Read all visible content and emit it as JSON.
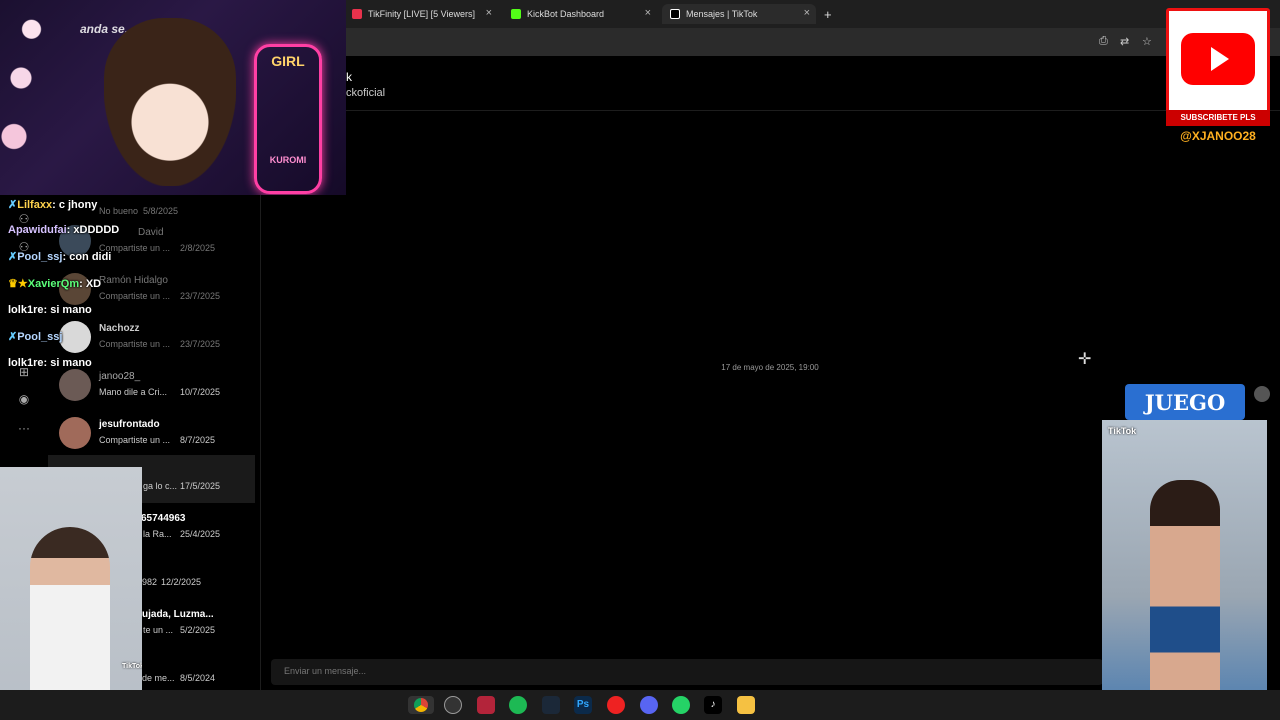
{
  "browser": {
    "tabs": [
      {
        "label": "TikFinity [LIVE] [5 Viewers]",
        "color": "#e8324c"
      },
      {
        "label": "KickBot Dashboard",
        "color": "#53fc18"
      },
      {
        "label": "Mensajes | TikTok",
        "color": "#ffffff"
      }
    ],
    "new_tab": "+",
    "close": "×"
  },
  "conversation": {
    "name": "k",
    "username": "ckoficial",
    "timestamp": "17 de mayo de 2025, 19:00",
    "composer_placeholder": "Enviar un mensaje..."
  },
  "sidebar": {
    "more": "···",
    "items": [
      {
        "name": "",
        "preview": "No bueno",
        "date": "5/8/2025",
        "dim": true
      },
      {
        "name": "David",
        "preview": "Compartiste un ...",
        "date": "2/8/2025",
        "dim": true
      },
      {
        "name": "Ramón Hidalgo",
        "preview": "Compartiste un ...",
        "date": "23/7/2025",
        "dim": true
      },
      {
        "name": "Nachozz",
        "preview": "Compartiste un ...",
        "date": "23/7/2025",
        "dim": true
      },
      {
        "name": "janoo28_",
        "preview": "Mano dile a Cri...",
        "date": "10/7/2025",
        "dim": true
      },
      {
        "name": "jesufrontado",
        "preview": "Compartiste un ...",
        "date": "8/7/2025",
        "dim": false
      },
      {
        "name": "",
        "preview": "ga lo c...",
        "date": "17/5/2025",
        "dim": false,
        "selected": true
      },
      {
        "name": "65744963",
        "preview": "la Ra...",
        "date": "25/4/2025",
        "dim": false
      },
      {
        "name": "",
        "preview": "982",
        "date": "12/2/2025",
        "dim": false
      },
      {
        "name": "ujada, Luzma...",
        "preview": "te un ...",
        "date": "5/2/2025",
        "dim": false
      },
      {
        "name": "",
        "preview": "de me...",
        "date": "8/5/2024",
        "dim": false
      }
    ]
  },
  "stream": {
    "chat": [
      {
        "user": "Lilfaxx",
        "text": "c jhony",
        "color": "gold"
      },
      {
        "user": "Apawidufai",
        "text": "xDDDDD",
        "color": "blue"
      },
      {
        "user": "Pool_ssj",
        "text": "con didi",
        "color": "blue"
      },
      {
        "user": "XavierQm",
        "text": "XD",
        "color": "green"
      },
      {
        "user": "lolk1re",
        "text": "si mano",
        "color": "none"
      },
      {
        "user": "Pool_ssj",
        "text": "",
        "color": "blue"
      },
      {
        "user": "lolk1re",
        "text": "si mano",
        "color": "none"
      }
    ],
    "webcam": {
      "sign": "GIRL",
      "sign2": "KUROMI",
      "caption": "anda se..."
    },
    "youtube": {
      "label": "SUBSCRIBETE PLS",
      "handle": "@XJANOO28"
    },
    "juego": "JUEGO",
    "tiktok_tag": "TikTok"
  },
  "taskbar": {
    "icons": [
      "chrome",
      "obs",
      "tiktok-live",
      "spotify",
      "steam",
      "photoshop",
      "app-red",
      "discord",
      "whatsapp",
      "tiktok",
      "explorer"
    ],
    "photoshop_label": "Ps"
  },
  "colors": {
    "youtube_red": "#e11111",
    "handle_orange": "#ffb020",
    "juego_blue": "#2a6fd1"
  }
}
